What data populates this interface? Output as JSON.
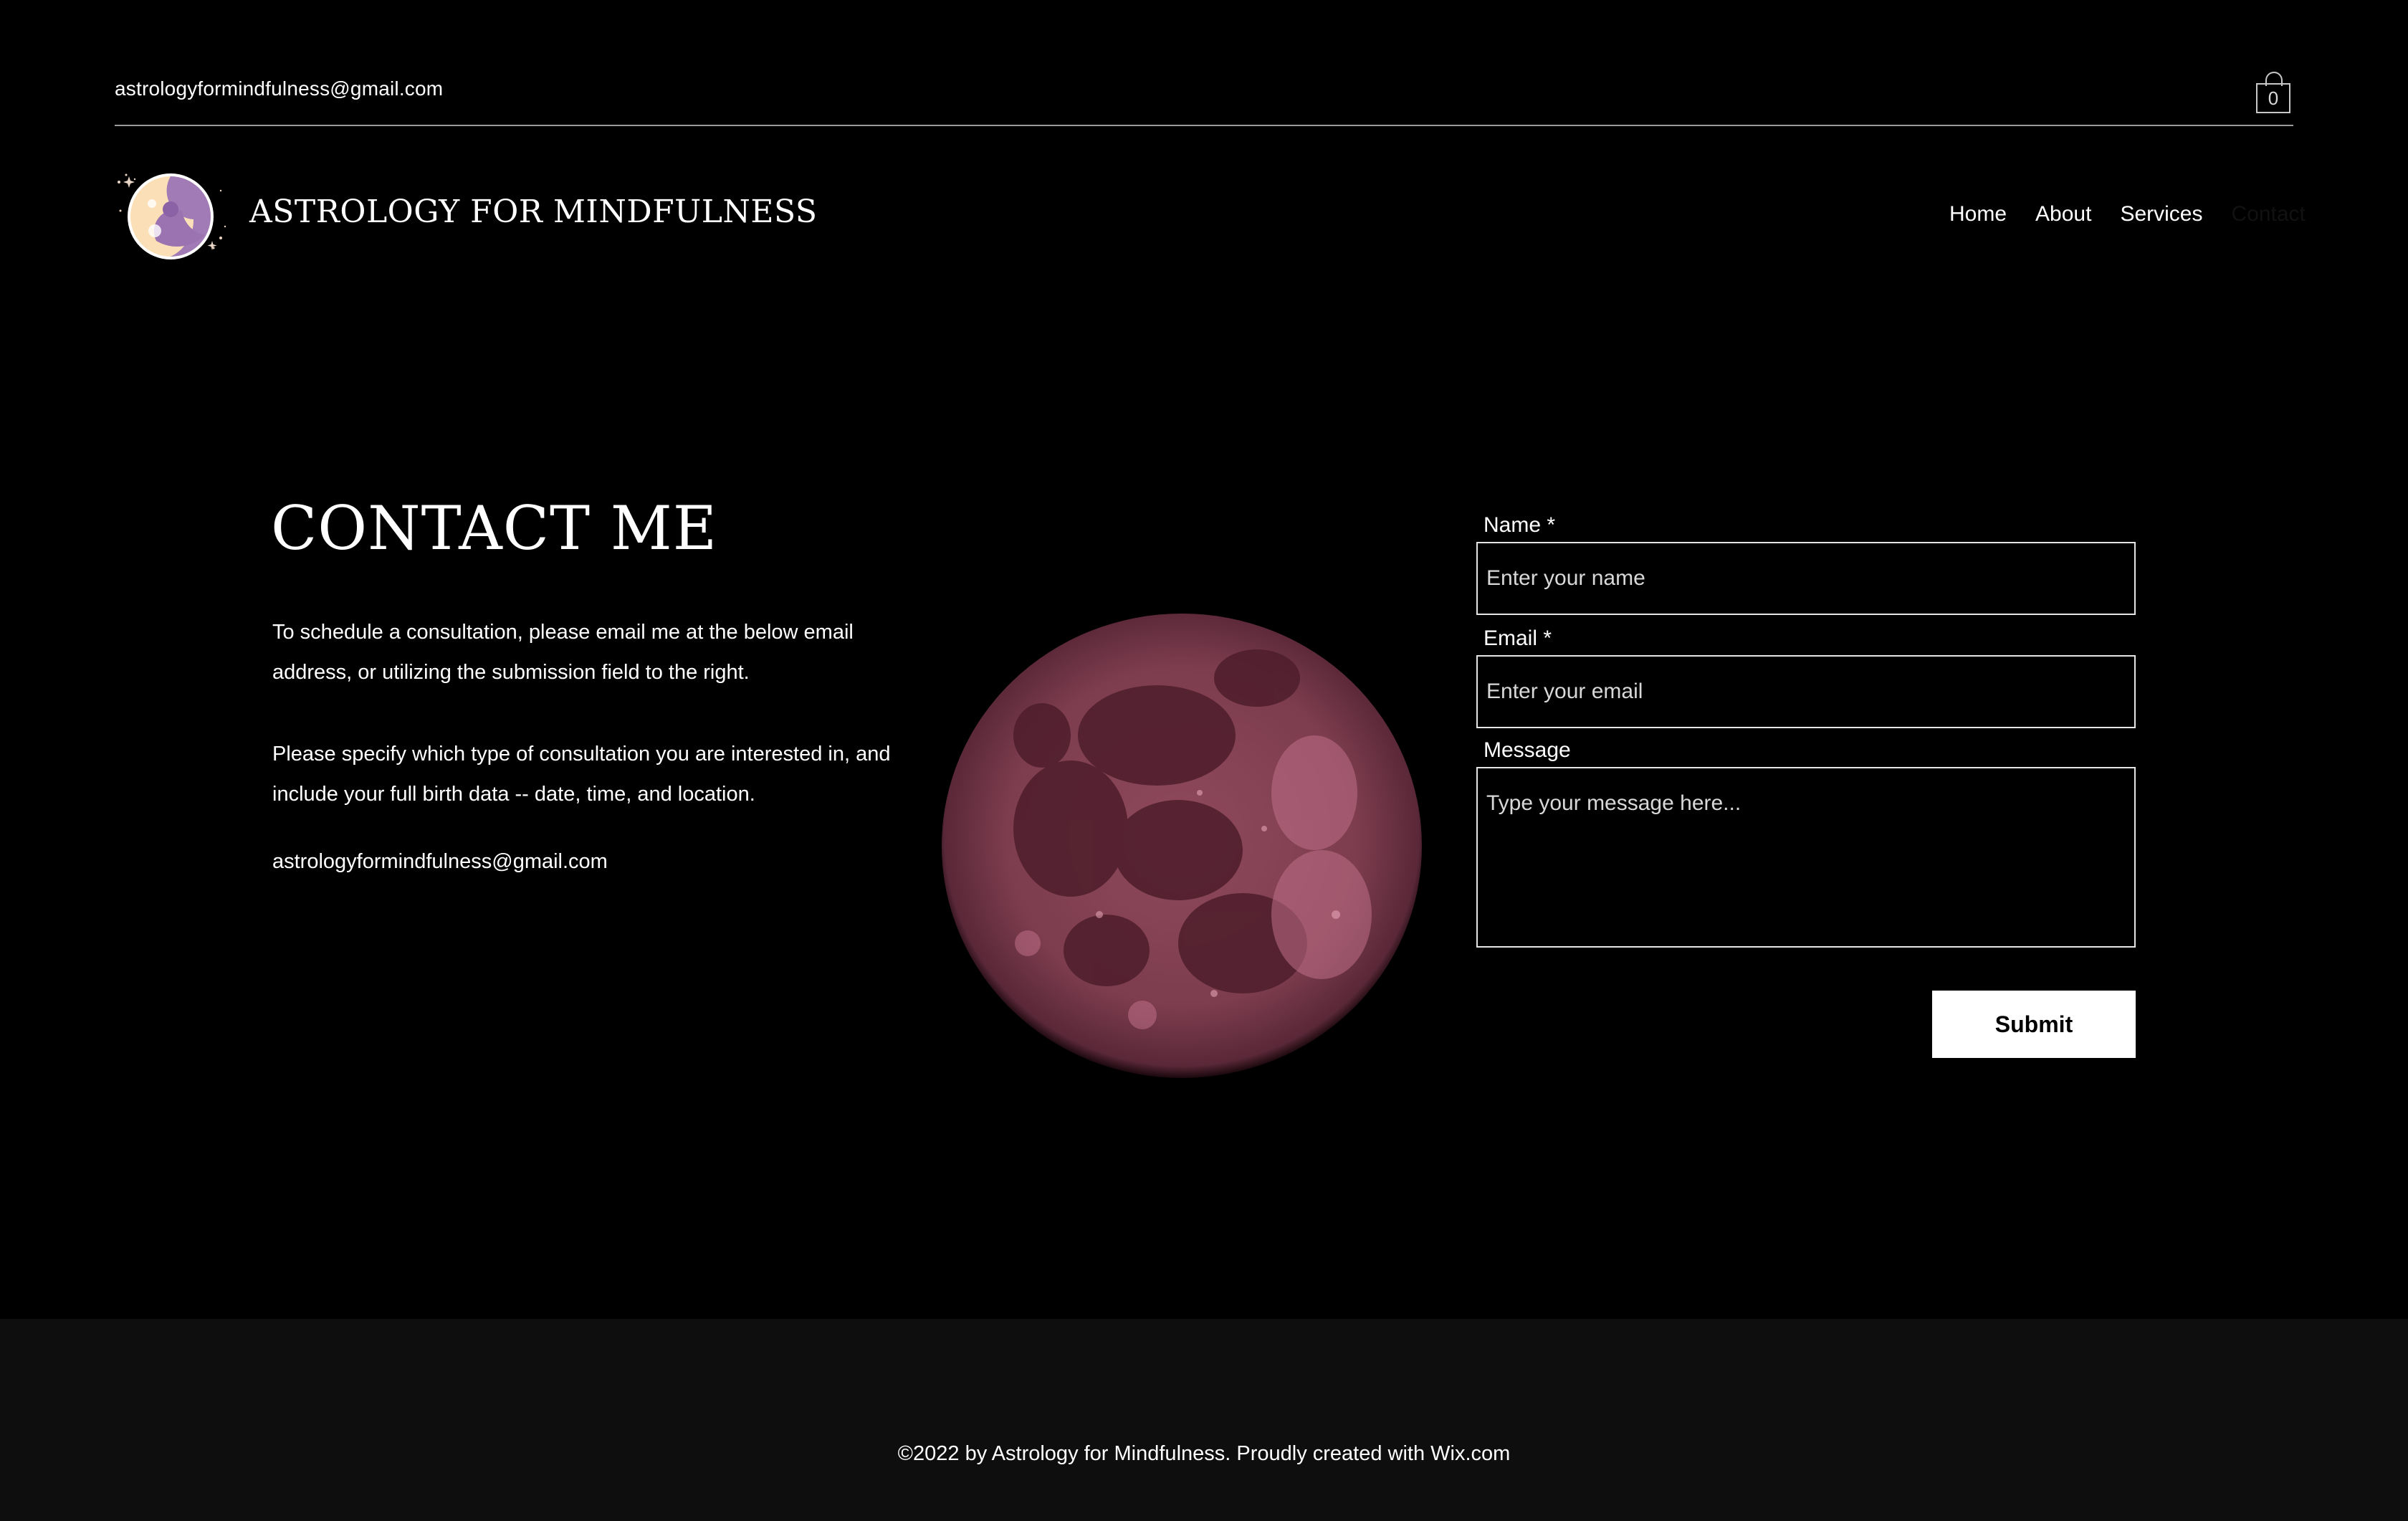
{
  "topbar": {
    "email": "astrologyformindfulness@gmail.com",
    "cart_count": "0"
  },
  "header": {
    "site_title": "ASTROLOGY FOR MINDFULNESS",
    "nav": [
      {
        "label": "Home"
      },
      {
        "label": "About"
      },
      {
        "label": "Services"
      },
      {
        "label": "Contact"
      }
    ]
  },
  "main": {
    "heading": "CONTACT ME",
    "paragraph1": "To schedule a consultation, please email me at the below email address, or utilizing the submission field to the right.",
    "paragraph2": "Please specify which type of consultation you are interested in, and include your full birth data -- date, time, and location.",
    "email": "astrologyformindfulness@gmail.com"
  },
  "form": {
    "name_label": "Name *",
    "name_placeholder": "Enter your name",
    "email_label": "Email *",
    "email_placeholder": "Enter your email",
    "message_label": "Message",
    "message_placeholder": "Type your message here...",
    "submit_label": "Submit"
  },
  "footer": {
    "text": "©2022 by Astrology for Mindfulness. Proudly created with Wix.com"
  },
  "colors": {
    "background": "#000000",
    "footer_background": "#0f0e0f",
    "moon": "#8a4456",
    "text": "#ffffff"
  }
}
